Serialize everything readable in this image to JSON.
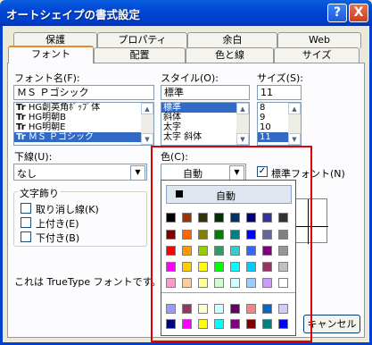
{
  "window": {
    "title": "オートシェイプの書式設定",
    "help_glyph": "?",
    "close_glyph": "X"
  },
  "tabs_row1": [
    "保護",
    "プロパティ",
    "余白",
    "Web"
  ],
  "tabs_row2": [
    "フォント",
    "配置",
    "色と線",
    "サイズ"
  ],
  "active_tab": "フォント",
  "font_name": {
    "label": "フォント名(F):",
    "value": "ＭＳ Ｐゴシック",
    "items": [
      "HG創英角ﾎﾟｯﾌﾟ体",
      "HG明朝B",
      "HG明朝E",
      "ＭＳ Ｐゴシック"
    ],
    "selected": "ＭＳ Ｐゴシック",
    "item_icon": "Tr"
  },
  "style": {
    "label": "スタイル(O):",
    "value": "標準",
    "items": [
      "標準",
      "斜体",
      "太字",
      "太字 斜体"
    ],
    "selected": "標準"
  },
  "size": {
    "label": "サイズ(S):",
    "value": "11",
    "items": [
      "8",
      "9",
      "10",
      "11"
    ],
    "selected": "11"
  },
  "underline": {
    "label": "下線(U):",
    "value": "なし"
  },
  "color": {
    "label": "色(C):",
    "value": "自動"
  },
  "normal_font": {
    "label": "標準フォント(N)",
    "checked": true
  },
  "effects": {
    "group_label": "文字飾り",
    "strikethrough": "取り消し線(K)",
    "superscript": "上付き(E)",
    "subscript": "下付き(B)"
  },
  "info_text": "これは TrueType フォントです。",
  "cancel_label": "キャンセル",
  "palette": {
    "auto_label": "自動",
    "rows": [
      [
        "#000000",
        "#993300",
        "#333300",
        "#003300",
        "#003366",
        "#000080",
        "#333399",
        "#333333"
      ],
      [
        "#800000",
        "#ff6600",
        "#808000",
        "#008000",
        "#008080",
        "#0000ff",
        "#666699",
        "#808080"
      ],
      [
        "#ff0000",
        "#ff9900",
        "#99cc00",
        "#339966",
        "#33cccc",
        "#3366ff",
        "#800080",
        "#969696"
      ],
      [
        "#ff00ff",
        "#ffcc00",
        "#ffff00",
        "#00ff00",
        "#00ffff",
        "#00ccff",
        "#993366",
        "#c0c0c0"
      ],
      [
        "#ff99cc",
        "#ffcc99",
        "#ffff99",
        "#ccffcc",
        "#ccffff",
        "#99ccff",
        "#cc99ff",
        "#ffffff"
      ],
      [
        "#9999ff",
        "#993366",
        "#ffffcc",
        "#ccffff",
        "#660066",
        "#ff8080",
        "#0066cc",
        "#ccccff"
      ],
      [
        "#000080",
        "#ff00ff",
        "#ffff00",
        "#00ffff",
        "#800080",
        "#800000",
        "#008080",
        "#0000ff"
      ]
    ]
  }
}
